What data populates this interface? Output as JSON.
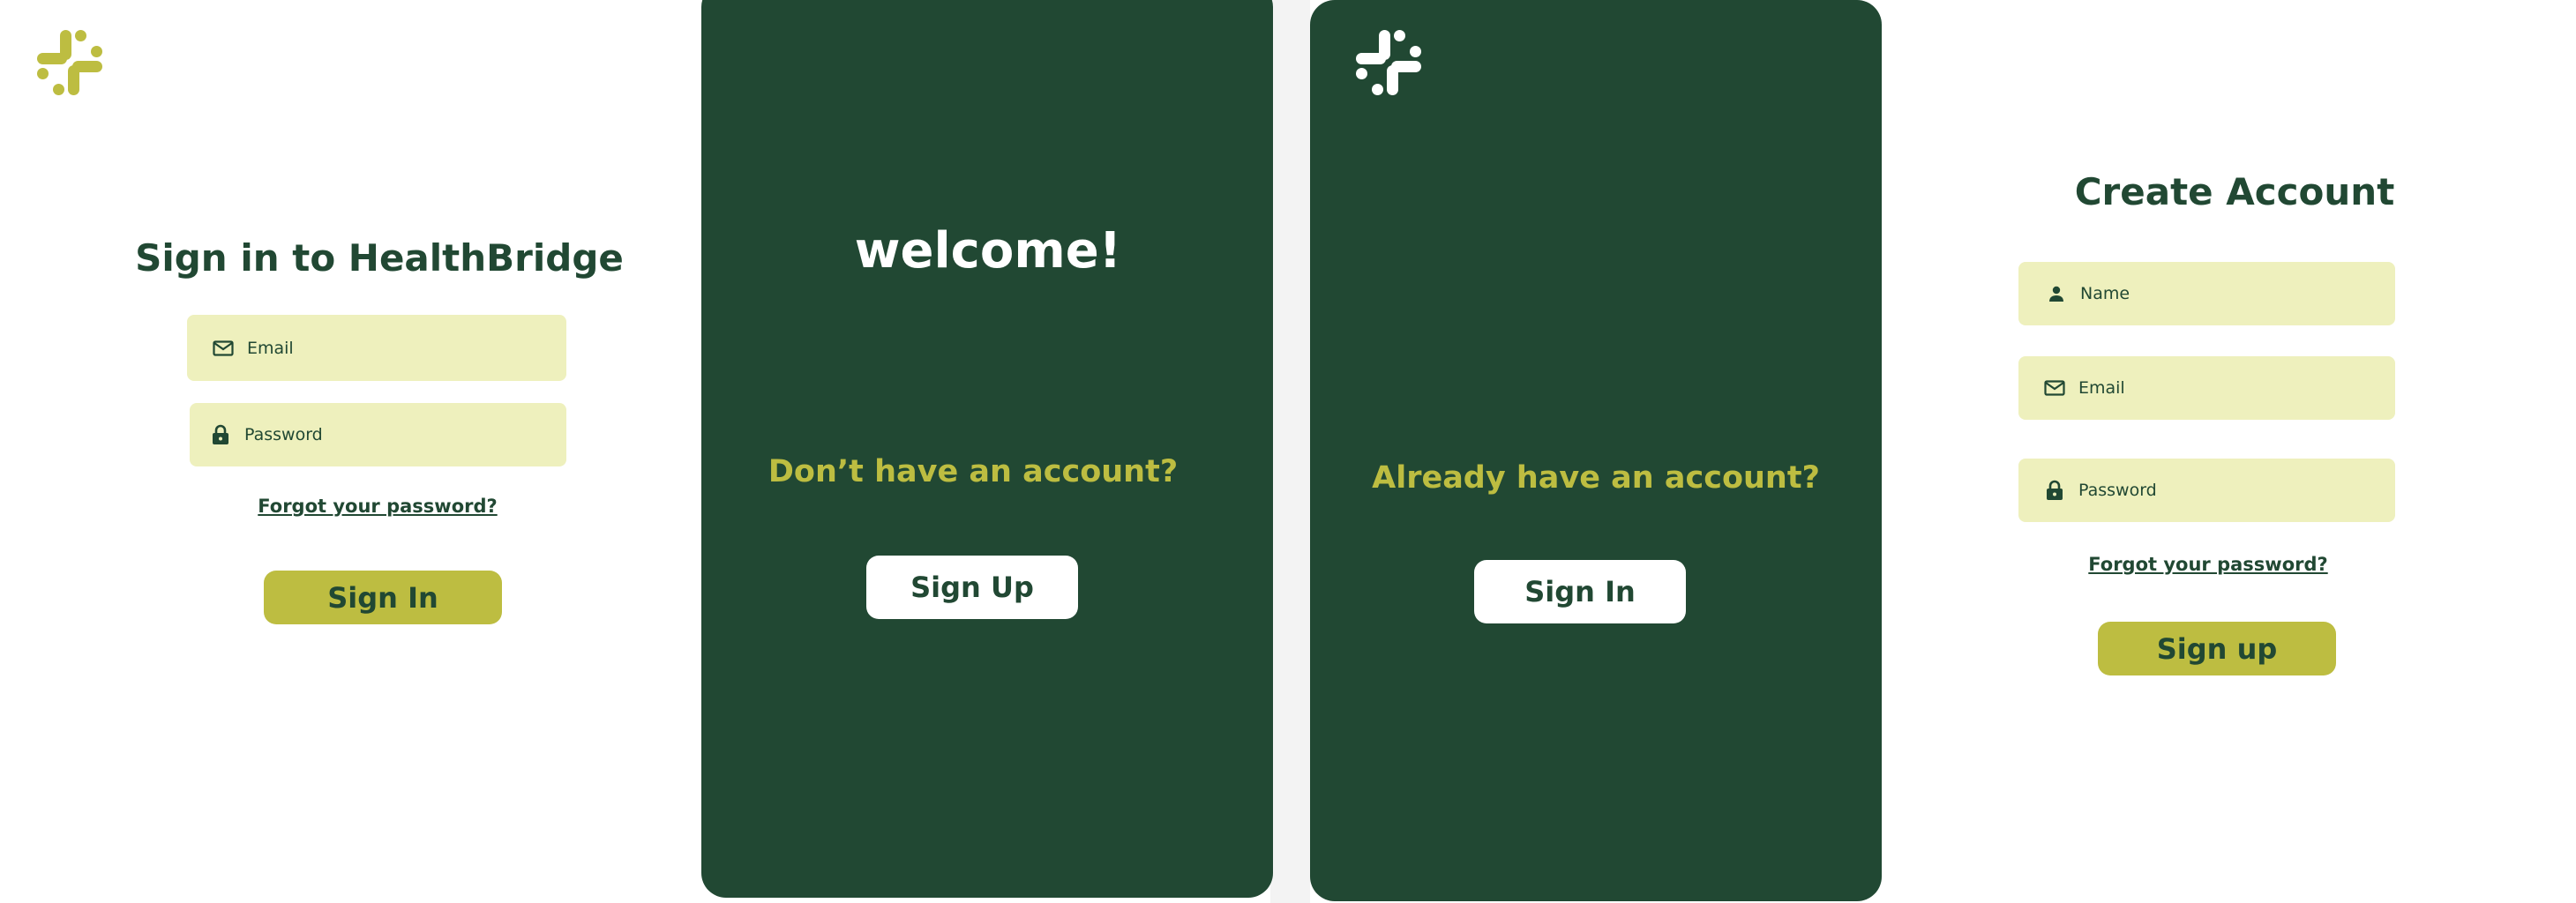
{
  "colors": {
    "brand_green": "#214833",
    "olive": "#bdbd41",
    "field_bg": "#eef0bd",
    "white": "#ffffff"
  },
  "signin_screen": {
    "logo_icon": "slack-style-hash-icon",
    "title": "Sign in to HealthBridge",
    "email": {
      "icon": "mail-icon",
      "placeholder": "Email"
    },
    "password": {
      "icon": "lock-icon",
      "placeholder": "Password"
    },
    "forgot_link": "Forgot your password?",
    "submit_label": "Sign In"
  },
  "welcome_screen": {
    "heading": "welcome!",
    "question": "Don’t have an account?",
    "button_label": "Sign Up"
  },
  "signin_prompt_screen": {
    "logo_icon": "slack-style-hash-icon",
    "question": "Already have an account?",
    "button_label": "Sign In"
  },
  "signup_screen": {
    "title": "Create Account",
    "name": {
      "icon": "person-icon",
      "placeholder": "Name"
    },
    "email": {
      "icon": "mail-icon",
      "placeholder": "Email"
    },
    "password": {
      "icon": "lock-icon",
      "placeholder": "Password"
    },
    "forgot_link": "Forgot your password?",
    "submit_label": "Sign up"
  }
}
